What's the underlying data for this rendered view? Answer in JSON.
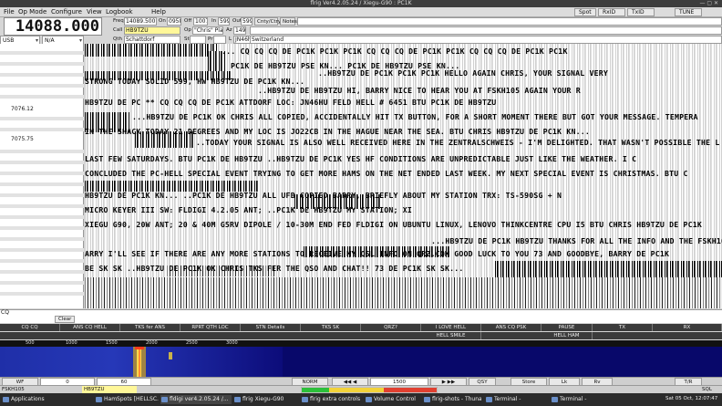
{
  "window": {
    "title": "flrig Ver4.2.05.24 / Xiegu-G90 : PC1K"
  },
  "menu": {
    "items": [
      "File",
      "Op Mode",
      "Configure",
      "View",
      "Logbook",
      "Help"
    ],
    "right_buttons": [
      "Spot",
      "RxID",
      "TxID",
      "TUNE"
    ]
  },
  "rig": {
    "frequency": "14088.000",
    "mode": "USB",
    "bandwidth": "N/A"
  },
  "log": {
    "freq_label": "Freq",
    "freq_value": "14089.500",
    "on_label": "On",
    "on_value": "0958",
    "off_label": "Off",
    "off_value": "1007",
    "in_label": "In",
    "in_value": "599",
    "out_label": "Out",
    "out_value": "599",
    "cnty_label": "Cnty/Ctry",
    "notes_label": "Notes",
    "call_label": "Call",
    "call_value": "HB9TZU",
    "op_label": "Op",
    "op_value": "\"Chris\" Planzer",
    "az_label": "Az",
    "az_value": "149",
    "qth_label": "Qth",
    "qth_value": "Schattdorf",
    "st_label": "St",
    "pr_label": "Pr",
    "l_label": "L",
    "loc_value": "JN46hu",
    "country_value": "Switzerland"
  },
  "left_panel": {
    "markers": [
      "7076.12",
      "7075.75"
    ]
  },
  "rx_lines": [
    "... CQ CQ CQ DE PC1K PC1K PC1K   CQ CQ CQ DE PC1K PC1K   CQ CQ CQ DE PC1K PC1K",
    "  PC1K DE HB9TZU PSE KN...              PC1K DE HB9TZU PSE KN...",
    "..HB9TZU DE PC1K PC1K PC1K HELLO AGAIN CHRIS, YOUR SIGNAL VERY",
    " STRONG TODAY SOLID 599, HW HB9TZU DE PC1K KN...",
    "..HB9TZU DE HB9TZU  HI, BARRY NICE TO HEAR YOU AT FSKH105 AGAIN  YOUR R",
    "HB9TZU DE PC  ** CQ CQ CQ DE PC1K ATTDORF LOC: JN46HU  FELD HELL # 6451  BTU PC1K DE HB9TZU",
    "...HB9TZU DE PC1K OK CHRIS ALL COPIED, ACCIDENTALLY HIT TX BUTTON, FOR A SHORT MOMENT THERE BUT GOT YOUR MESSAGE. TEMPERA",
    "IN THE SHACK TODAY 21 DEGREES AND MY LOC IS JO22CB IN THE HAGUE NEAR THE SEA. BTU CHRIS HB9TZU DE PC1K KN...",
    "..TODAY YOUR SIGNAL IS ALSO WELL RECEIVED HERE IN THE ZENTRALSCHWEIS - I'M DELIGHTED. THAT WASN'T POSSIBLE THE L",
    "LAST FEW SATURDAYS.   BTU PC1K DE HB9TZU   ..HB9TZU DE PC1K YES HF CONDITIONS ARE UNPREDICTABLE JUST LIKE THE WEATHER. I C",
    "CONCLUDED THE PC-HELL SPECIAL EVENT TRYING TO GET MORE HAMS ON THE NET ENDED LAST WEEK. MY NEXT SPECIAL EVENT IS CHRISTMAS. BTU C",
    "HB9TZU DE PC1K KN...     ..PC1K DE HB9TZU  ALL UFB COPIED BARRY, BRIEFLY ABOUT MY STATION  TRX: TS-590SG + N",
    "MICRO KEYER III  SW: FLDIGI 4.2.05  ANT;                                   ..PC1K DE HB9TZU  MY STATION; XI",
    "XIEGU G90, 20W  ANT; 20 & 40M G5RV DIPOLE / 10-30M END FED  FLDIGI ON UBUNTU LINUX, LENOVO THINKCENTRE CPU I5  BTU CHRIS HB9TZU DE PC1K",
    "...HB9TZU DE PC1K HB9TZU  THANKS FOR ALL THE INFO AND THE FSKH105 QSO BAR",
    "ARRY  I'LL SEE IF THERE ARE ANY MORE STATIONS TO RECEIVE  MY QSL INFO ON QRZ.COM  GOOD LUCK TO YOU  73 AND GOODBYE, BARRY DE PC1K",
    "BE SK SK   ..HB9TZU DE PC1K OK CHRIS TKS FER THE QSO AND CHAT!! 73 DE PC1K SK SK..."
  ],
  "tx_panel": {
    "label": "CQ",
    "clear_label": "Clear"
  },
  "macros_row1": [
    "CQ CQ",
    "ANS CQ HELL",
    "TKS fer ANS",
    "RPRT QTH LOC",
    "STN Details",
    "TKS SK",
    "QRZ?",
    "I LOVE HELL",
    "ANS CQ PSK",
    "PAUSE",
    "TX",
    "RX"
  ],
  "macros_row2": [
    "HELL SMILE",
    "HELL HAM"
  ],
  "ruler": [
    "500",
    "1000",
    "1500",
    "2000",
    "2500",
    "3000"
  ],
  "waterfall_ctl": {
    "wf_label": "WF",
    "left_value": "0",
    "mid_value": "60",
    "norm_label": "NORM",
    "cursor_value": "1500",
    "qsy_label": "QSY",
    "store_label": "Store",
    "lk_label": "Lk",
    "rv_label": "Rv",
    "tr_label": "T/R"
  },
  "status": {
    "mode": "FSKH105",
    "call": "HB9TZU",
    "sql_label": "SQL"
  },
  "taskbar": {
    "apps_label": "Applications",
    "items": [
      "HamSpots [HELLSC...",
      "fldigi ver4.2.05.24 /...",
      "flrig Xiegu-G90",
      "flrig extra controls",
      "Volume Control",
      "flrig-shots - Thunar",
      "Terminal -",
      "Terminal -"
    ],
    "clock": "Sat 05 Oct, 12:07:47"
  },
  "colors": {
    "waterfall_bg": "#0a0a6e",
    "signal": "#ff3b1a",
    "call_field": "#fff799",
    "macro_bg": "#3b3b3b"
  }
}
